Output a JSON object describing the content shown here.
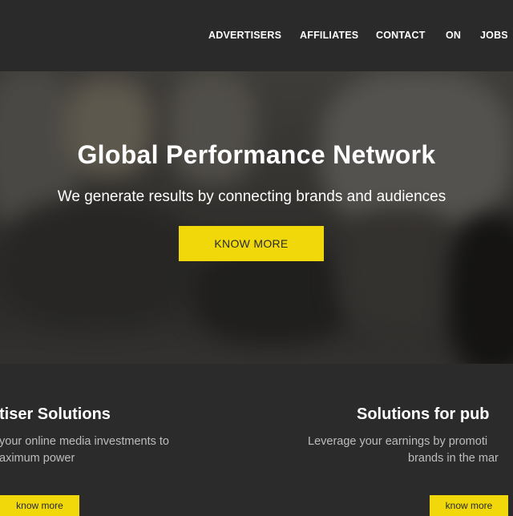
{
  "nav": {
    "items": [
      {
        "label": "ADVERTISERS"
      },
      {
        "label": "AFFILIATES"
      },
      {
        "label": "CONTACT"
      },
      {
        "label": "ON"
      },
      {
        "label": "JOBS"
      }
    ]
  },
  "hero": {
    "title": "Global Performance Network",
    "subtitle": "We generate results by connecting brands and audiences",
    "cta_label": "KNOW MORE"
  },
  "solutions": {
    "advertisers": {
      "title": "tiser Solutions",
      "text_line1": "your online media investments to",
      "text_line2": "aximum power",
      "button_label": "know more"
    },
    "publishers": {
      "title": "Solutions for pub",
      "text_line1": "Leverage your earnings by promoti",
      "text_line2": "brands in the mar",
      "button_label": "know more"
    }
  },
  "colors": {
    "accent": "#f0d80b",
    "background": "#2b2b2b",
    "header": "#2a2a2a"
  }
}
